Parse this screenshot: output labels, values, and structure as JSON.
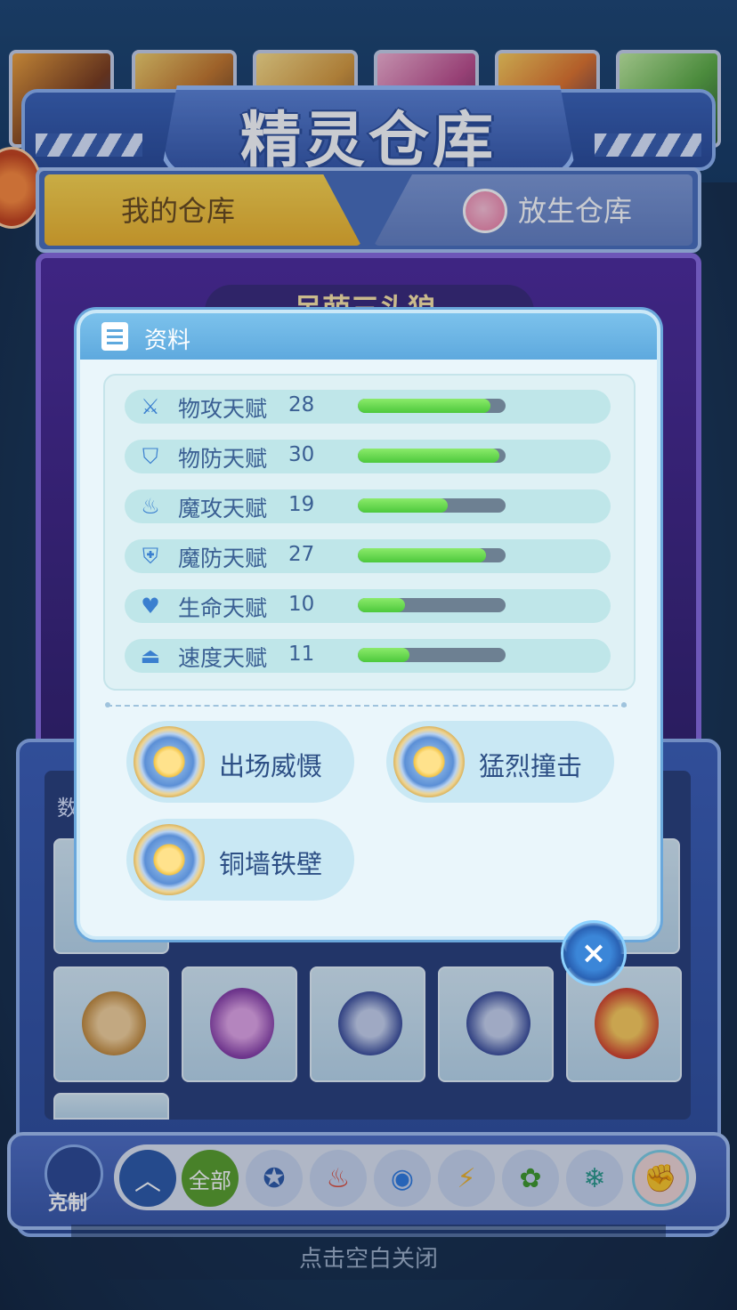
{
  "banner": {
    "title": "精灵仓库"
  },
  "tabs": {
    "my_storage": "我的仓库",
    "release_storage": "放生仓库"
  },
  "pet_name": "呆萌三头狼",
  "grid_label": "数",
  "popup": {
    "title": "资料",
    "stats": [
      {
        "icon": "sword-icon",
        "label": "物攻天赋",
        "value": "28",
        "fill": 0.9
      },
      {
        "icon": "shield-icon",
        "label": "物防天赋",
        "value": "30",
        "fill": 0.96
      },
      {
        "icon": "flame-icon",
        "label": "魔攻天赋",
        "value": "19",
        "fill": 0.61
      },
      {
        "icon": "magic-shield-icon",
        "label": "魔防天赋",
        "value": "27",
        "fill": 0.87
      },
      {
        "icon": "heart-plus-icon",
        "label": "生命天赋",
        "value": "10",
        "fill": 0.32
      },
      {
        "icon": "boot-icon",
        "label": "速度天赋",
        "value": "11",
        "fill": 0.35
      }
    ],
    "skills": [
      "出场威慑",
      "猛烈撞击",
      "铜墙铁壁"
    ]
  },
  "filter": {
    "restrain_label": "克制",
    "all_label": "全部",
    "types": [
      "up-icon",
      "all",
      "normal-icon",
      "fire-icon",
      "water-icon",
      "electric-icon",
      "grass-icon",
      "ice-icon",
      "fist-icon"
    ]
  },
  "close_hint": "点击空白关闭",
  "colors": {
    "accent": "#5ea9de",
    "bar_fill": "#4cc93c",
    "tab_active": "#f0b42a"
  }
}
